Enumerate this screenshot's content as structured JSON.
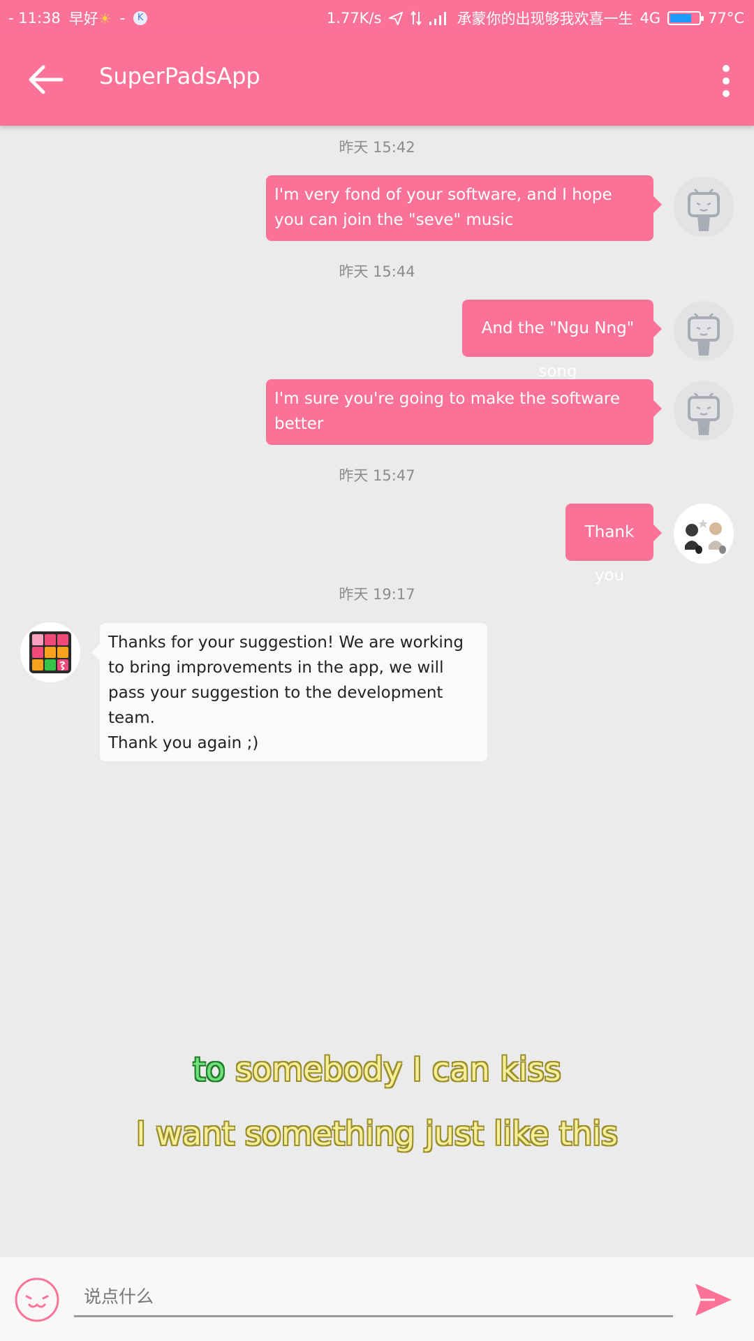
{
  "status_bar": {
    "time": "- 11:38",
    "greeting": "早好",
    "dash": "-",
    "k_badge": "K",
    "net_speed": "1.77K/s",
    "carrier": "承蒙你的出现够我欢喜一生",
    "network": "4G",
    "battery_level": 0.75,
    "temperature": "77°C"
  },
  "toolbar": {
    "title": "SuperPadsApp",
    "back_icon": "arrow-left-icon",
    "more_icon": "more-vert-icon"
  },
  "messages": [
    {
      "timestamp": "昨天 15:42",
      "direction": "out",
      "text": "I'm very fond of your software, and I hope you can join the \"seve\" music",
      "avatar": "tv-mascot-avatar"
    },
    {
      "timestamp": "昨天 15:44",
      "direction": "out",
      "text": "And the \"Ngu Nng\" song",
      "avatar": "tv-mascot-avatar"
    },
    {
      "timestamp": "",
      "direction": "out",
      "text": "I'm sure you're going to make the software better",
      "avatar": "tv-mascot-avatar"
    },
    {
      "timestamp": "昨天 15:47",
      "direction": "out",
      "text": "Thank you",
      "avatar": "anime-couple-avatar"
    },
    {
      "timestamp": "昨天 19:17",
      "direction": "in",
      "text": "Thanks for your suggestion! We are working to bring improvements in the app, we will pass your suggestion to the development team.\nThank you again ;)",
      "avatar": "superpads-app-icon"
    }
  ],
  "lyrics": {
    "line1_sung": "to",
    "line1_rest": " somebody I can kiss",
    "line2": "I want something just like this"
  },
  "input": {
    "placeholder": "说点什么",
    "value": "",
    "emoji_icon": "smiley-face-icon",
    "send_icon": "send-icon"
  },
  "colors": {
    "accent": "#fb7299",
    "background": "#ebebeb",
    "incoming_bubble": "#fafafa"
  }
}
